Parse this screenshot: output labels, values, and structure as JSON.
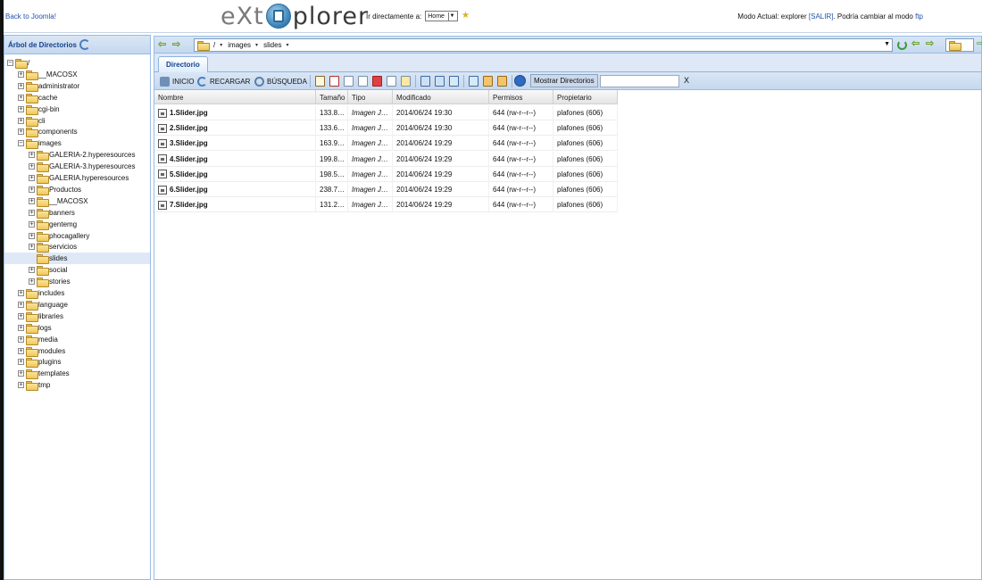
{
  "header": {
    "back_link": "Back to Joomla!",
    "logo_left": "eXt",
    "logo_right": "plorer",
    "goto_label": "Ir directamente a:",
    "goto_value": "Home",
    "mode_prefix": "Modo Actual: explorer ",
    "mode_exit": "[SALIR]",
    "mode_middle": ". Podría cambiar al modo ",
    "mode_ftp": "ftp"
  },
  "tree": {
    "title": "Árbol de Directorios",
    "nodes": [
      {
        "label": "/",
        "expander": "−"
      },
      {
        "label": "__MACOSX",
        "expander": "+"
      },
      {
        "label": "administrator",
        "expander": "+"
      },
      {
        "label": "cache",
        "expander": "+"
      },
      {
        "label": "cgi-bin",
        "expander": "+"
      },
      {
        "label": "cli",
        "expander": "+"
      },
      {
        "label": "components",
        "expander": "+"
      },
      {
        "label": "images",
        "expander": "−"
      },
      {
        "label": "GALERIA-2.hyperesources",
        "expander": "+"
      },
      {
        "label": "GALERIA-3.hyperesources",
        "expander": "+"
      },
      {
        "label": "GALERIA.hyperesources",
        "expander": "+"
      },
      {
        "label": "Productos",
        "expander": "+"
      },
      {
        "label": "__MACOSX",
        "expander": "+"
      },
      {
        "label": "banners",
        "expander": "+"
      },
      {
        "label": "gentemg",
        "expander": "+"
      },
      {
        "label": "phocagallery",
        "expander": "+"
      },
      {
        "label": "servicios",
        "expander": "+"
      },
      {
        "label": "slides",
        "expander": ""
      },
      {
        "label": "social",
        "expander": "+"
      },
      {
        "label": "stories",
        "expander": "+"
      },
      {
        "label": "includes",
        "expander": "+"
      },
      {
        "label": "language",
        "expander": "+"
      },
      {
        "label": "libraries",
        "expander": "+"
      },
      {
        "label": "logs",
        "expander": "+"
      },
      {
        "label": "media",
        "expander": "+"
      },
      {
        "label": "modules",
        "expander": "+"
      },
      {
        "label": "plugins",
        "expander": "+"
      },
      {
        "label": "templates",
        "expander": "+"
      },
      {
        "label": "tmp",
        "expander": "+"
      }
    ]
  },
  "path": {
    "crumbs": [
      "/",
      "images",
      "slides"
    ]
  },
  "tabs": {
    "directory": "Directorio"
  },
  "toolbar": {
    "home": "INICIO",
    "reload": "RECARGAR",
    "search": "BÚSQUEDA",
    "show_dirs": "Mostrar Directorios",
    "filter_clear": "X"
  },
  "grid": {
    "columns": [
      "Nombre",
      "Tamaño",
      "Tipo",
      "Modificado",
      "Permisos",
      "Propietario"
    ],
    "rows": [
      {
        "name": "1.Slider.jpg",
        "size": "133.8…",
        "type": "Imagen J…",
        "modified": "2014/06/24 19:30",
        "perms": "644 (rw-r--r--)",
        "owner": "plafones (606)"
      },
      {
        "name": "2.Slider.jpg",
        "size": "133.6…",
        "type": "Imagen J…",
        "modified": "2014/06/24 19:30",
        "perms": "644 (rw-r--r--)",
        "owner": "plafones (606)"
      },
      {
        "name": "3.Slider.jpg",
        "size": "163.9…",
        "type": "Imagen J…",
        "modified": "2014/06/24 19:29",
        "perms": "644 (rw-r--r--)",
        "owner": "plafones (606)"
      },
      {
        "name": "4.Slider.jpg",
        "size": "199.8…",
        "type": "Imagen J…",
        "modified": "2014/06/24 19:29",
        "perms": "644 (rw-r--r--)",
        "owner": "plafones (606)"
      },
      {
        "name": "5.Slider.jpg",
        "size": "198.5…",
        "type": "Imagen J…",
        "modified": "2014/06/24 19:29",
        "perms": "644 (rw-r--r--)",
        "owner": "plafones (606)"
      },
      {
        "name": "6.Slider.jpg",
        "size": "238.7…",
        "type": "Imagen J…",
        "modified": "2014/06/24 19:29",
        "perms": "644 (rw-r--r--)",
        "owner": "plafones (606)"
      },
      {
        "name": "7.Slider.jpg",
        "size": "131.2…",
        "type": "Imagen J…",
        "modified": "2014/06/24 19:29",
        "perms": "644 (rw-r--r--)",
        "owner": "plafones (606)"
      }
    ]
  },
  "colors": {
    "link": "#2452a6",
    "panel_border": "#99bbe8",
    "panel_header": "#c5d8ef",
    "title_text": "#15428b",
    "selection": "#dfe8f6"
  }
}
